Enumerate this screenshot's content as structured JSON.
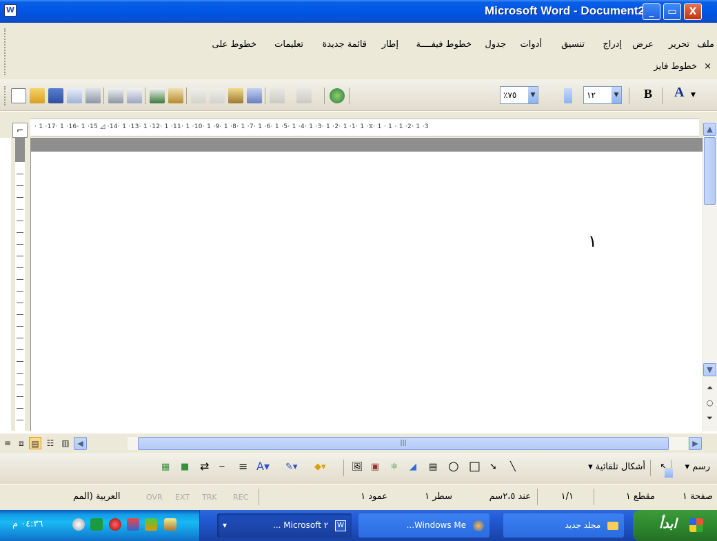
{
  "window": {
    "title": "Microsoft Word - Document2",
    "app_icon": "W",
    "buttons": {
      "minimize": "_",
      "maximize": "▭",
      "close": "X"
    }
  },
  "menu": {
    "items": [
      "ملف",
      "تحرير",
      "عرض",
      "إدراج",
      "تنسيق",
      "أدوات",
      "جدول",
      "خطوط فيفــــة",
      "إطار",
      "قائمة جديدة",
      "تعليمات",
      "خطوط على"
    ],
    "row2": "خطوط فايز",
    "row2_close": "×"
  },
  "toolbar": {
    "zoom": "٪٧٥",
    "font_size": "١٢",
    "bold": "B",
    "font_color": "A"
  },
  "ruler": {
    "corner": "⌐",
    "text": "· 1 ·17· 1 ·16· 1 ·15 ◿ ·14· 1 ·13· 1 ·12· 1 ·11· 1 ·10· 1 ·9· 1 ·8· 1 ·7· 1 ·6· 1 ·5· 1 ·4· 1 ·3· 1 ·2· 1 ·1· 1 ·⧖· 1 · 1 · 1 ·2· 1 ·3"
  },
  "document": {
    "page_number": "١"
  },
  "view_buttons": [
    "≡",
    "⧈",
    "▤",
    "☷",
    "▥"
  ],
  "drawing_toolbar": {
    "draw_label": "▾ رسم",
    "autoshapes_label": "▾ أشكال تلقائية",
    "tools": [
      "↖",
      "╲",
      "➘",
      "□",
      "○",
      "▤",
      "◢",
      "⚛",
      "▣",
      "🖼",
      "◆▾",
      "✎▾",
      "A▾",
      "≡",
      "┄",
      "⇄",
      "■",
      "▦"
    ]
  },
  "statusbar": {
    "page": "صفحة ١",
    "section": "مقطع ١",
    "pages": "١/١",
    "at": "عند ٢،٥سم",
    "line": "سطر ١",
    "column": "عمود ١",
    "rec": "REC",
    "trk": "TRK",
    "ext": "EXT",
    "ovr": "OVR",
    "language": "العربية (المم"
  },
  "taskbar": {
    "start": "ابدأ",
    "tasks": [
      "مجلد جديد",
      "...Windows Me",
      "... Microsoft ٢"
    ],
    "clock": "٠٤:٣٦ م"
  },
  "colors": {
    "titlebar": "#0054e3",
    "menubar": "#ece9d8",
    "taskbar": "#245edb",
    "start": "#3c9a3c"
  }
}
